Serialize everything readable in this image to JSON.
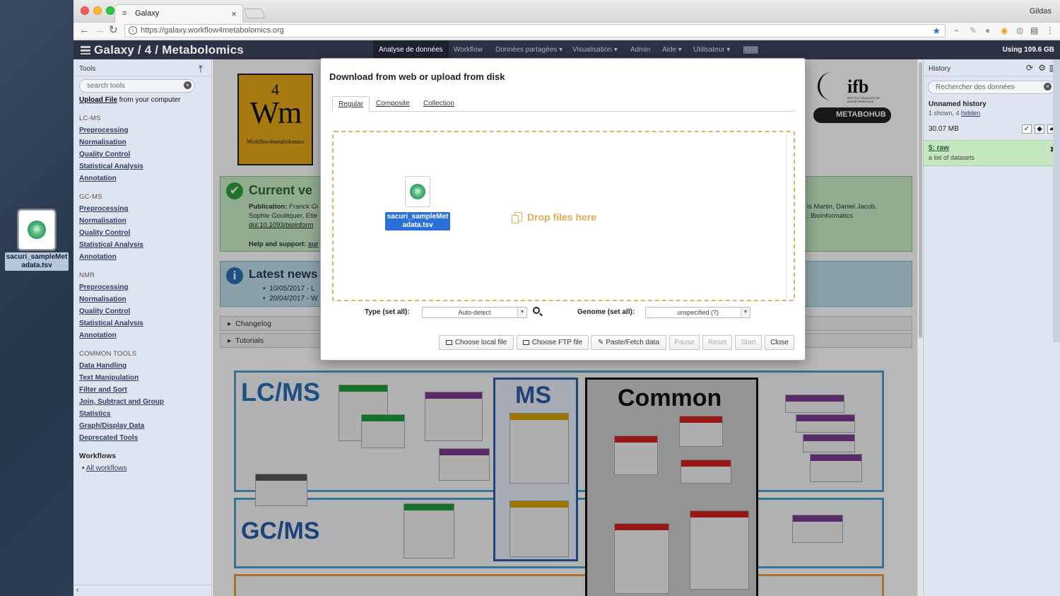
{
  "desktop": {
    "file_name": "sacuri_sampleMetadata.tsv"
  },
  "browser": {
    "tab_title": "Galaxy",
    "user": "Gildas",
    "url": "https://galaxy.workflow4metabolomics.org"
  },
  "masthead": {
    "brand": "Galaxy / 4 / Metabolomics",
    "menus": [
      "Analyse de données",
      "Workflow",
      "Données partagées ▾",
      "Visualisation ▾",
      "Admin",
      "Aide ▾",
      "Utilisateur ▾"
    ],
    "quota": "Using 109.6 GB"
  },
  "tools": {
    "title": "Tools",
    "search_placeholder": "search tools",
    "upload_link": "Upload File",
    "upload_suffix": " from your computer",
    "sections": [
      {
        "name": "LC-MS",
        "items": [
          "Preprocessing",
          "Normalisation",
          "Quality Control",
          "Statistical Analysis",
          "Annotation"
        ]
      },
      {
        "name": "GC-MS",
        "items": [
          "Preprocessing",
          "Normalisation",
          "Quality Control",
          "Statistical Analysis",
          "Annotation"
        ]
      },
      {
        "name": "NMR",
        "items": [
          "Preprocessing",
          "Normalisation",
          "Quality Control",
          "Statistical Analysis",
          "Annotation"
        ]
      },
      {
        "name": "COMMON TOOLS",
        "items": [
          "Data Handling",
          "Text Manipulation",
          "Filter and Sort",
          "Join, Subtract and Group",
          "Statistics",
          "Graph/Display Data",
          "Deprecated Tools"
        ]
      }
    ],
    "workflows_title": "Workflows",
    "all_workflows": "All workflows"
  },
  "center": {
    "logo": {
      "four": "4",
      "wm": "Wm",
      "sub": "Workflow4metabolomics"
    },
    "current_version": {
      "heading": "Current ve",
      "pub_label": "Publication:",
      "pub_text": " Franck Gi",
      "line2": "Sophie Goulitquer, Etie",
      "doi": "doi:10.1093/bioinform",
      "right1": "is Martin, Daniel Jacob,",
      "right2": ", Bioinformatics",
      "help_label": "Help and support:",
      "help_link": "sur"
    },
    "latest_news": {
      "heading": "Latest news",
      "items": [
        "10/05/2017 - L",
        "20/04/2017 - W"
      ]
    },
    "accordions": [
      "Changelog",
      "Tutorials"
    ],
    "ifb": {
      "top": "ifb",
      "sub": "INSTITUT FRANÇAIS DE BIOINFORMATIQUE",
      "bottom": "METABOHUB"
    },
    "diagram": {
      "lc": "LC/MS",
      "ms": "MS",
      "common": "Common",
      "gc": "GC/MS"
    }
  },
  "history": {
    "title": "History",
    "search_placeholder": "Rechercher des données",
    "name": "Unnamed history",
    "count_prefix": "1 shown, 4 ",
    "count_link": "hidden",
    "size": "30.07 MB",
    "dataset": {
      "title": "5: raw",
      "subtitle": "a list of datasets"
    }
  },
  "modal": {
    "title": "Download from web or upload from disk",
    "tabs": [
      "Regular",
      "Composite",
      "Collection"
    ],
    "drop_text": "Drop files here",
    "dragged_file_line1": "sacuri_sampleMet",
    "dragged_file_line2": "adata.tsv",
    "type_label": "Type (set all):",
    "type_value": "Auto-detect",
    "genome_label": "Genome (set all):",
    "genome_value": "unspecified (?)",
    "buttons": {
      "local": "Choose local file",
      "ftp": "Choose FTP file",
      "paste": "Paste/Fetch data",
      "pause": "Pause",
      "reset": "Reset",
      "start": "Start",
      "close": "Close"
    }
  },
  "colors": {
    "masthead": "#2c3143",
    "panel": "#dfe5f0",
    "drop_border": "#e1b25e",
    "drop_text": "#e6a951",
    "selection": "#2b6fd8"
  }
}
